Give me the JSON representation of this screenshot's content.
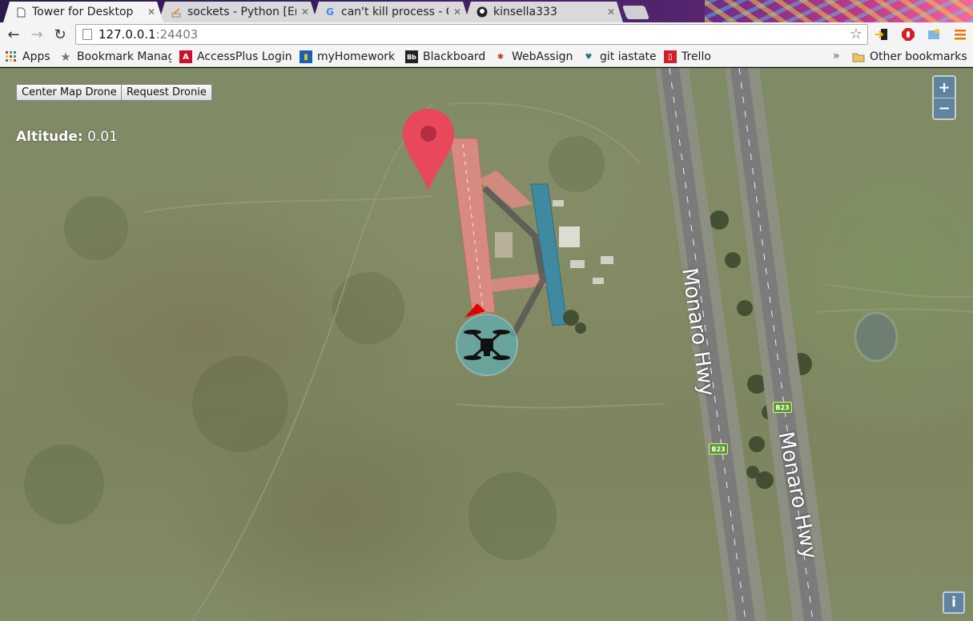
{
  "browser": {
    "tabs": [
      {
        "title": "Tower for Desktop",
        "icon": "page-icon"
      },
      {
        "title": "sockets - Python [Er",
        "icon": "stackoverflow-icon"
      },
      {
        "title": "can't kill process - Go",
        "icon": "google-icon"
      },
      {
        "title": "kinsella333",
        "icon": "github-icon"
      }
    ],
    "url_host": "127.0.0.1",
    "url_port": ":24403",
    "bookmarks": [
      {
        "label": "Apps",
        "icon": "apps-grid-icon"
      },
      {
        "label": "Bookmark Manag",
        "icon": "star-icon"
      },
      {
        "label": "AccessPlus Login",
        "icon": "accessplus-icon"
      },
      {
        "label": "myHomework",
        "icon": "myhomework-icon"
      },
      {
        "label": "Blackboard",
        "icon": "blackboard-icon"
      },
      {
        "label": "WebAssign",
        "icon": "webassign-icon"
      },
      {
        "label": "git iastate",
        "icon": "git-icon"
      },
      {
        "label": "Trello",
        "icon": "trello-icon"
      }
    ],
    "more_bookmarks": "»",
    "other_bookmarks": "Other bookmarks"
  },
  "app": {
    "center_button": "Center Map Drone",
    "dronie_button": "Request Dronie",
    "altitude_label": "Altitude:",
    "altitude_value": "0.01",
    "zoom_in": "+",
    "zoom_out": "−",
    "info": "i"
  },
  "map": {
    "road_name_1": "Monaro Hwy",
    "road_name_2": "Monaro Hwy",
    "route_shield_1": "B23",
    "route_shield_2": "B23",
    "marker_color": "#e8475c",
    "drone_circle_color": "#5bb8c4",
    "heading_arrow_color": "#e00000"
  }
}
